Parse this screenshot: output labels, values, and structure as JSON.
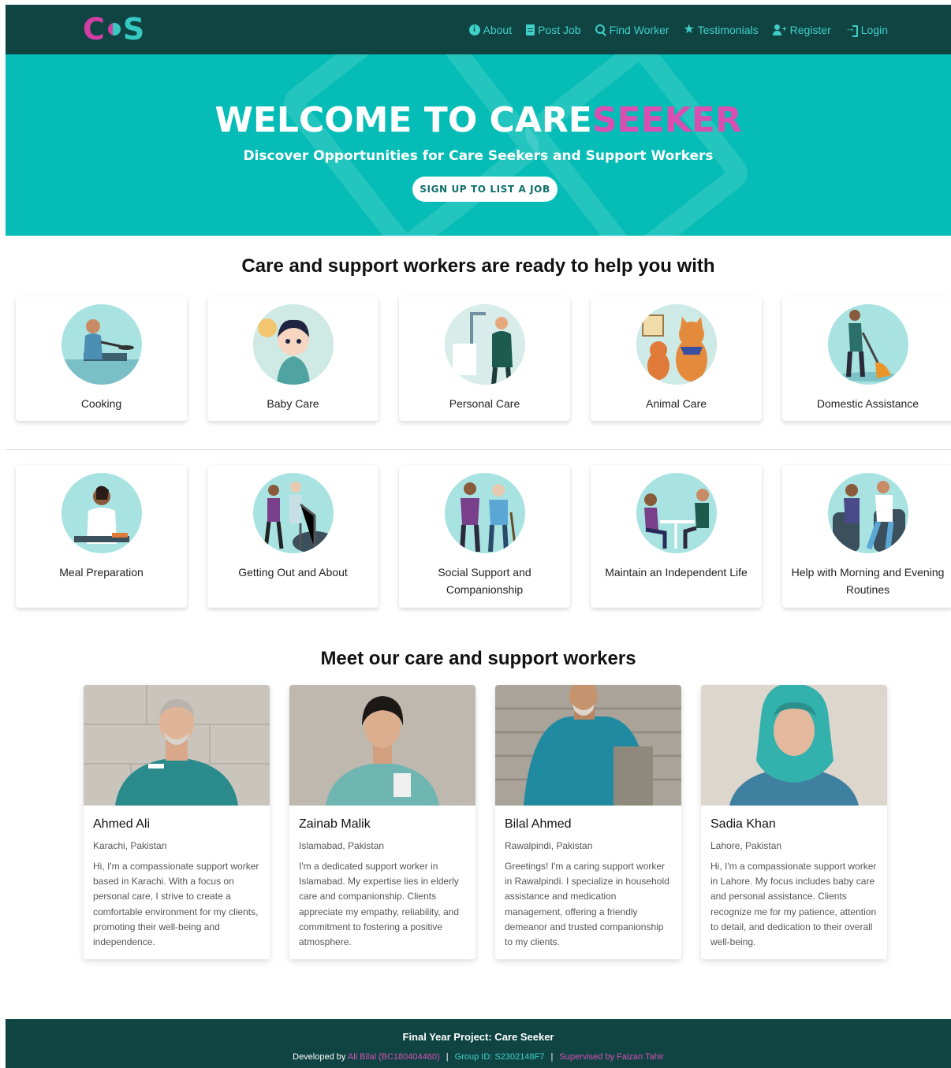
{
  "brand": {
    "logo_c": "C",
    "logo_s": "S",
    "colors": {
      "dark_teal": "#0f4443",
      "teal": "#05bdb6",
      "accent_teal": "#3fd0c8",
      "pink": "#d94fb1"
    }
  },
  "nav": {
    "items": [
      {
        "label": "About",
        "icon": "info-circle-icon"
      },
      {
        "label": "Post Job",
        "icon": "document-icon"
      },
      {
        "label": "Find Worker",
        "icon": "search-icon"
      },
      {
        "label": "Testimonials",
        "icon": "star-icon"
      },
      {
        "label": "Register",
        "icon": "user-plus-icon"
      },
      {
        "label": "Login",
        "icon": "login-icon"
      }
    ]
  },
  "hero": {
    "title_white": "WELCOME TO CARE",
    "title_pink": "SEEKER",
    "subtitle": "Discover Opportunities for Care Seekers and Support Workers",
    "cta": "SIGN UP TO LIST A JOB"
  },
  "services": {
    "title": "Care and support workers are ready to help you with",
    "items": [
      {
        "label": "Cooking",
        "icon": "cooking-illustration"
      },
      {
        "label": "Baby Care",
        "icon": "baby-care-illustration"
      },
      {
        "label": "Personal Care",
        "icon": "personal-care-illustration"
      },
      {
        "label": "Animal Care",
        "icon": "animal-care-illustration"
      },
      {
        "label": "Domestic Assistance",
        "icon": "domestic-assistance-illustration"
      },
      {
        "label": "Meal Preparation",
        "icon": "meal-preparation-illustration"
      },
      {
        "label": "Getting Out and About",
        "icon": "getting-out-illustration"
      },
      {
        "label": "Social Support and Companionship",
        "icon": "social-support-illustration"
      },
      {
        "label": "Maintain an Independent Life",
        "icon": "independent-life-illustration"
      },
      {
        "label": "Help with Morning and Evening Routines",
        "icon": "routines-illustration"
      }
    ]
  },
  "workers": {
    "title": "Meet our care and support workers",
    "items": [
      {
        "name": "Ahmed Ali",
        "location": "Karachi, Pakistan",
        "bio": "Hi, I'm a compassionate support worker based in Karachi. With a focus on personal care, I strive to create a comfortable environment for my clients, promoting their well-being and independence."
      },
      {
        "name": "Zainab Malik",
        "location": "Islamabad, Pakistan",
        "bio": "I'm a dedicated support worker in Islamabad. My expertise lies in elderly care and companionship. Clients appreciate my empathy, reliability, and commitment to fostering a positive atmosphere."
      },
      {
        "name": "Bilal Ahmed",
        "location": "Rawalpindi, Pakistan",
        "bio": "Greetings! I'm a caring support worker in Rawalpindi. I specialize in household assistance and medication management, offering a friendly demeanor and trusted companionship to my clients."
      },
      {
        "name": "Sadia Khan",
        "location": "Lahore, Pakistan",
        "bio": "Hi, I'm a compassionate support worker in Lahore. My focus includes baby care and personal assistance. Clients recognize me for my patience, attention to detail, and dedication to their overall well-being."
      }
    ]
  },
  "footer": {
    "title": "Final Year Project: Care Seeker",
    "developed_prefix": "Developed by",
    "developer": "Ali Bilal (BC180404460)",
    "group": "Group ID: S2302148F7",
    "supervisor": "Supervised by Faizan Tahir",
    "separator": "|"
  }
}
